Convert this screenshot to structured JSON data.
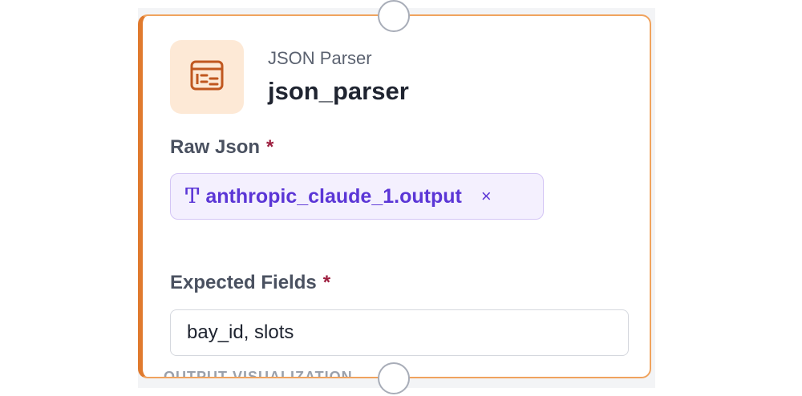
{
  "node": {
    "type_label": "JSON Parser",
    "name": "json_parser",
    "icon": "table-parser-icon",
    "accent_color": "#e07a2e",
    "icon_bg_color": "#fde9d6"
  },
  "fields": {
    "raw_json": {
      "label": "Raw Json",
      "required_mark": "*",
      "chip": {
        "type_icon": "Ͳ",
        "value": "anthropic_claude_1.output",
        "close": "×"
      }
    },
    "expected_fields": {
      "label": "Expected Fields",
      "required_mark": "*",
      "value": "bay_id, slots"
    }
  },
  "next_section": {
    "label": "OUTPUT VISUALIZATION"
  },
  "colors": {
    "chip_text": "#5b36d6",
    "required": "#9d1e3e"
  }
}
